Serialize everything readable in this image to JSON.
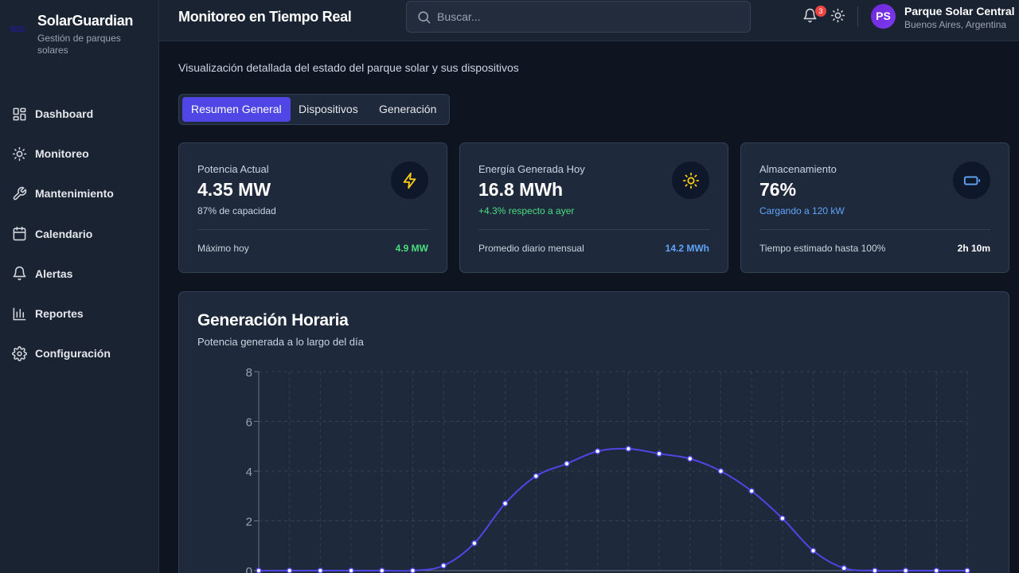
{
  "brand": {
    "logo": "SGS",
    "title": "SolarGuardian",
    "subtitle": "Gestión de parques solares"
  },
  "sidebar": {
    "items": [
      {
        "label": "Dashboard",
        "icon": "dashboard-icon"
      },
      {
        "label": "Monitoreo",
        "icon": "sun-icon"
      },
      {
        "label": "Mantenimiento",
        "icon": "wrench-icon"
      },
      {
        "label": "Calendario",
        "icon": "calendar-icon"
      },
      {
        "label": "Alertas",
        "icon": "bell-icon"
      },
      {
        "label": "Reportes",
        "icon": "bar-chart-icon"
      },
      {
        "label": "Configuración",
        "icon": "gear-icon"
      }
    ]
  },
  "header": {
    "title": "Monitoreo en Tiempo Real",
    "search_placeholder": "Buscar...",
    "notifications_count": "3",
    "user_initials": "PS",
    "park_name": "Parque Solar Central",
    "park_location": "Buenos Aires, Argentina"
  },
  "main": {
    "intro": "Visualización detallada del estado del parque solar y sus dispositivos",
    "tabs": [
      {
        "label": "Resumen General",
        "active": true
      },
      {
        "label": "Dispositivos",
        "active": false
      },
      {
        "label": "Generación",
        "active": false
      }
    ],
    "cards": [
      {
        "label": "Potencia Actual",
        "value": "4.35 MW",
        "sub": "87% de capacidad",
        "sub_color": "#cbd5e1",
        "icon": "lightning-icon",
        "icon_color": "#facc15",
        "foot_label": "Máximo hoy",
        "foot_value": "4.9 MW",
        "foot_color": "#4ade80"
      },
      {
        "label": "Energía Generada Hoy",
        "value": "16.8 MWh",
        "sub": "+4.3% respecto a ayer",
        "sub_color": "#4ade80",
        "icon": "sun-icon",
        "icon_color": "#facc15",
        "foot_label": "Promedio diario mensual",
        "foot_value": "14.2 MWh",
        "foot_color": "#60a5fa"
      },
      {
        "label": "Almacenamiento",
        "value": "76%",
        "sub": "Cargando a 120 kW",
        "sub_color": "#60a5fa",
        "icon": "battery-icon",
        "icon_color": "#60a5fa",
        "foot_label": "Tiempo estimado hasta 100%",
        "foot_value": "2h 10m",
        "foot_color": "#ffffff"
      }
    ]
  },
  "chart": {
    "title": "Generación Horaria",
    "subtitle": "Potencia generada a lo largo del día"
  },
  "chart_data": {
    "type": "line",
    "title": "Generación Horaria",
    "subtitle": "Potencia generada a lo largo del día",
    "ylim": [
      0,
      8
    ],
    "yticks": [
      "0",
      "2",
      "4",
      "6",
      "8"
    ],
    "grid": true,
    "line_color": "#4f46e5",
    "series": [
      {
        "values": [
          0,
          0,
          0,
          0,
          0,
          0,
          0.2,
          1.1,
          2.7,
          3.8,
          4.3,
          4.8,
          4.9,
          4.7,
          4.5,
          4.0,
          3.2,
          2.1,
          0.8,
          0.1,
          0,
          0,
          0,
          0
        ]
      }
    ]
  }
}
